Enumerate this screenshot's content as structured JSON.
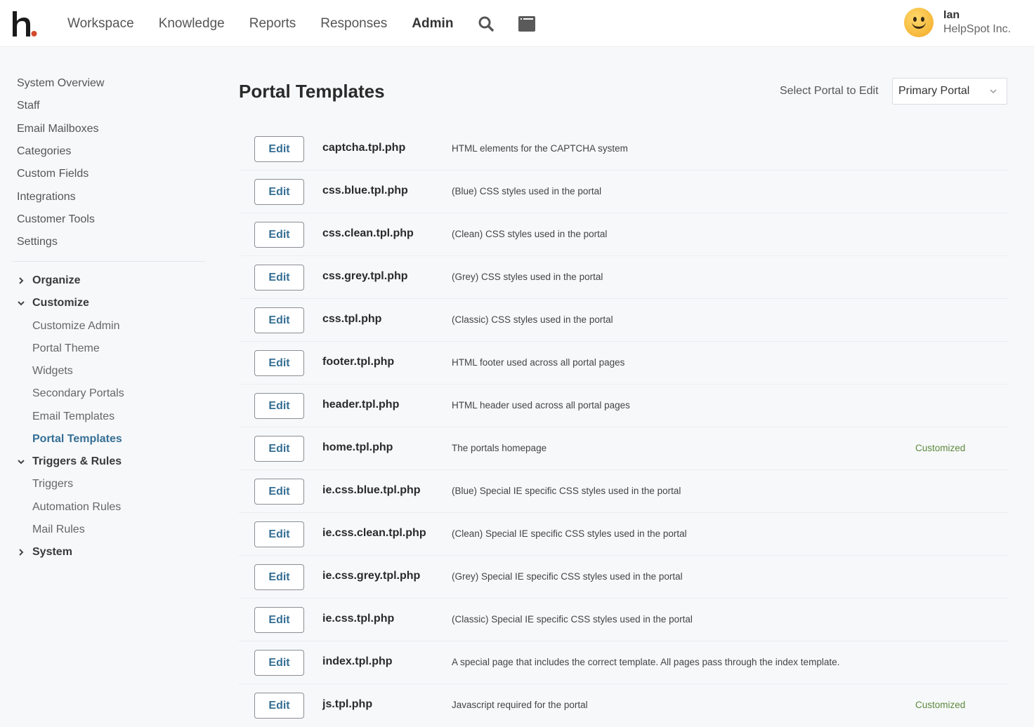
{
  "topbar": {
    "logo_alt": "h.",
    "nav": [
      {
        "label": "Workspace",
        "active": false
      },
      {
        "label": "Knowledge",
        "active": false
      },
      {
        "label": "Reports",
        "active": false
      },
      {
        "label": "Responses",
        "active": false
      },
      {
        "label": "Admin",
        "active": true
      }
    ],
    "icons": [
      "search-icon",
      "window-icon"
    ],
    "user": {
      "name": "Ian",
      "org": "HelpSpot Inc."
    }
  },
  "colors": {
    "accent": "#356f94",
    "logo_dot": "#d24a2c",
    "customized": "#5c8a3c"
  },
  "sidebar": {
    "items": [
      {
        "label": "System Overview"
      },
      {
        "label": "Staff"
      },
      {
        "label": "Email Mailboxes"
      },
      {
        "label": "Categories"
      },
      {
        "label": "Custom Fields"
      },
      {
        "label": "Integrations"
      },
      {
        "label": "Customer Tools"
      },
      {
        "label": "Settings"
      }
    ],
    "groups": [
      {
        "label": "Organize",
        "expanded": false,
        "children": []
      },
      {
        "label": "Customize",
        "expanded": true,
        "children": [
          {
            "label": "Customize Admin"
          },
          {
            "label": "Portal Theme"
          },
          {
            "label": "Widgets"
          },
          {
            "label": "Secondary Portals"
          },
          {
            "label": "Email Templates"
          },
          {
            "label": "Portal Templates",
            "active": true
          }
        ]
      },
      {
        "label": "Triggers & Rules",
        "expanded": true,
        "children": [
          {
            "label": "Triggers"
          },
          {
            "label": "Automation Rules"
          },
          {
            "label": "Mail Rules"
          }
        ]
      },
      {
        "label": "System",
        "expanded": false,
        "children": []
      }
    ]
  },
  "main": {
    "title": "Portal Templates",
    "select_label": "Select Portal to Edit",
    "select_value": "Primary Portal",
    "edit_label": "Edit",
    "templates": [
      {
        "file": "captcha.tpl.php",
        "desc": "HTML elements for the CAPTCHA system",
        "status": ""
      },
      {
        "file": "css.blue.tpl.php",
        "desc": "(Blue) CSS styles used in the portal",
        "status": ""
      },
      {
        "file": "css.clean.tpl.php",
        "desc": "(Clean) CSS styles used in the portal",
        "status": ""
      },
      {
        "file": "css.grey.tpl.php",
        "desc": "(Grey) CSS styles used in the portal",
        "status": ""
      },
      {
        "file": "css.tpl.php",
        "desc": "(Classic) CSS styles used in the portal",
        "status": ""
      },
      {
        "file": "footer.tpl.php",
        "desc": "HTML footer used across all portal pages",
        "status": ""
      },
      {
        "file": "header.tpl.php",
        "desc": "HTML header used across all portal pages",
        "status": ""
      },
      {
        "file": "home.tpl.php",
        "desc": "The portals homepage",
        "status": "Customized"
      },
      {
        "file": "ie.css.blue.tpl.php",
        "desc": "(Blue) Special IE specific CSS styles used in the portal",
        "status": ""
      },
      {
        "file": "ie.css.clean.tpl.php",
        "desc": "(Clean) Special IE specific CSS styles used in the portal",
        "status": ""
      },
      {
        "file": "ie.css.grey.tpl.php",
        "desc": "(Grey) Special IE specific CSS styles used in the portal",
        "status": ""
      },
      {
        "file": "ie.css.tpl.php",
        "desc": "(Classic) Special IE specific CSS styles used in the portal",
        "status": ""
      },
      {
        "file": "index.tpl.php",
        "desc": "A special page that includes the correct template. All pages pass through the index template.",
        "status": ""
      },
      {
        "file": "js.tpl.php",
        "desc": "Javascript required for the portal",
        "status": "Customized"
      }
    ]
  }
}
